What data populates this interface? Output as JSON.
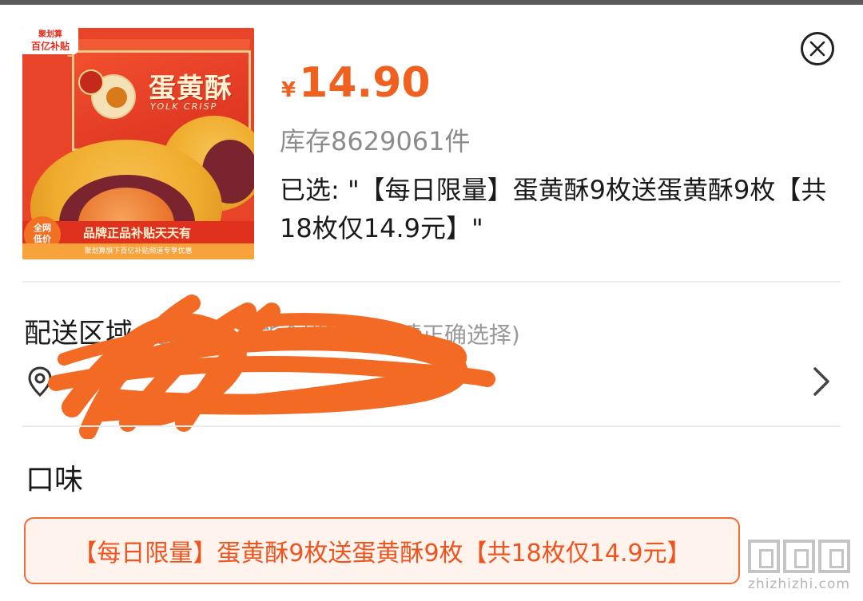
{
  "product": {
    "image": {
      "badge_line1": "聚划算",
      "badge_line2": "百亿补贴",
      "title": "蛋黄酥",
      "subtitle": "YOLK CRISP",
      "low_price_line1": "全网",
      "low_price_line2": "低价",
      "banner": "品牌正品补贴天天有",
      "footer": "聚划算旗下百亿补贴频道专享优惠"
    },
    "price_symbol": "¥",
    "price": "14.90",
    "stock": "库存8629061件",
    "selected": "已选: \"【每日限量】蛋黄酥9枚送蛋黄酥9枚【共18枚仅14.9元】\""
  },
  "delivery": {
    "label": "配送区域",
    "hint": "(配送区域可能会影响库存,请正确选择)",
    "address": ""
  },
  "flavor": {
    "label": "口味",
    "options": [
      {
        "label": "【每日限量】蛋黄酥9枚送蛋黄酥9枚【共18枚仅14.9元】",
        "selected": true
      }
    ]
  },
  "watermark": {
    "text": "zhizhizhi.com"
  },
  "colors": {
    "accent": "#f0601e",
    "chip_border": "#f06a3a",
    "chip_background": "#fff3ee",
    "scribble": "#f26a24"
  }
}
